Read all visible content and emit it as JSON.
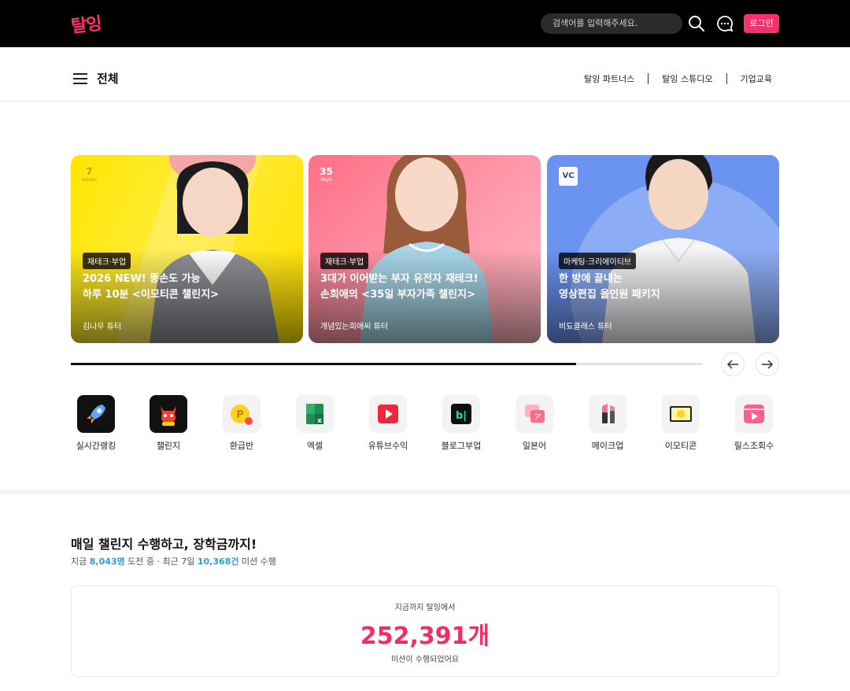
{
  "header": {
    "logo": "탈잉",
    "search_placeholder": "검색어를 입력해주세요.",
    "login_label": "로그인"
  },
  "nav": {
    "title": "전체",
    "links": [
      "탈잉 파트너스",
      "탈잉 스튜디오",
      "기업교육"
    ]
  },
  "cards": [
    {
      "tag": "재테크·부업",
      "title": "2026 NEW! 똥손도 가능\n하루 10분 <이모티콘 챌린지>",
      "tutor": "김나무 튜터",
      "corner": "7",
      "corner_sub": "weeks"
    },
    {
      "tag": "재테크·부업",
      "title": "3대가 이어받는 부자 유전자 재테크!\n손희애의 <35일 부자가족 챌린지>",
      "tutor": "개념있는희애씨 튜터",
      "corner": "35",
      "corner_sub": "days"
    },
    {
      "tag": "마케팅·크리에이티브",
      "title": "한 방에 끝내는\n영상편집 올인원 패키지",
      "tutor": "비됴클래스 튜터",
      "corner": "VC",
      "corner_sub": ""
    }
  ],
  "carousel_progress": 0.8,
  "categories": [
    {
      "label": "실시간랭킹",
      "icon": "rocket-icon"
    },
    {
      "label": "챌린지",
      "icon": "devil-icon"
    },
    {
      "label": "환급반",
      "icon": "coin-icon"
    },
    {
      "label": "엑셀",
      "icon": "excel-icon"
    },
    {
      "label": "유튜브수익",
      "icon": "youtube-icon"
    },
    {
      "label": "블로그부업",
      "icon": "blog-icon"
    },
    {
      "label": "일본어",
      "icon": "japanese-icon"
    },
    {
      "label": "메이크업",
      "icon": "lipstick-icon"
    },
    {
      "label": "이모티콘",
      "icon": "emoticon-icon"
    },
    {
      "label": "릴스조회수",
      "icon": "reels-icon"
    }
  ],
  "challenge": {
    "title": "매일 챌린지 수행하고, 장학금까지!",
    "sub_prefix": "지금 ",
    "participants": "8,043명",
    "sub_mid": " 도전 중 · 최근 7일 ",
    "missions": "10,368건",
    "sub_suffix": " 미션 수행",
    "box_top": "지금까지 탈잉에서",
    "total": "252,391개",
    "box_bottom": "미션이 수행되었어요"
  },
  "colors": {
    "brand": "#ff2f6e",
    "accent_blue": "#2a9de0",
    "stat": "#ee2e67"
  }
}
